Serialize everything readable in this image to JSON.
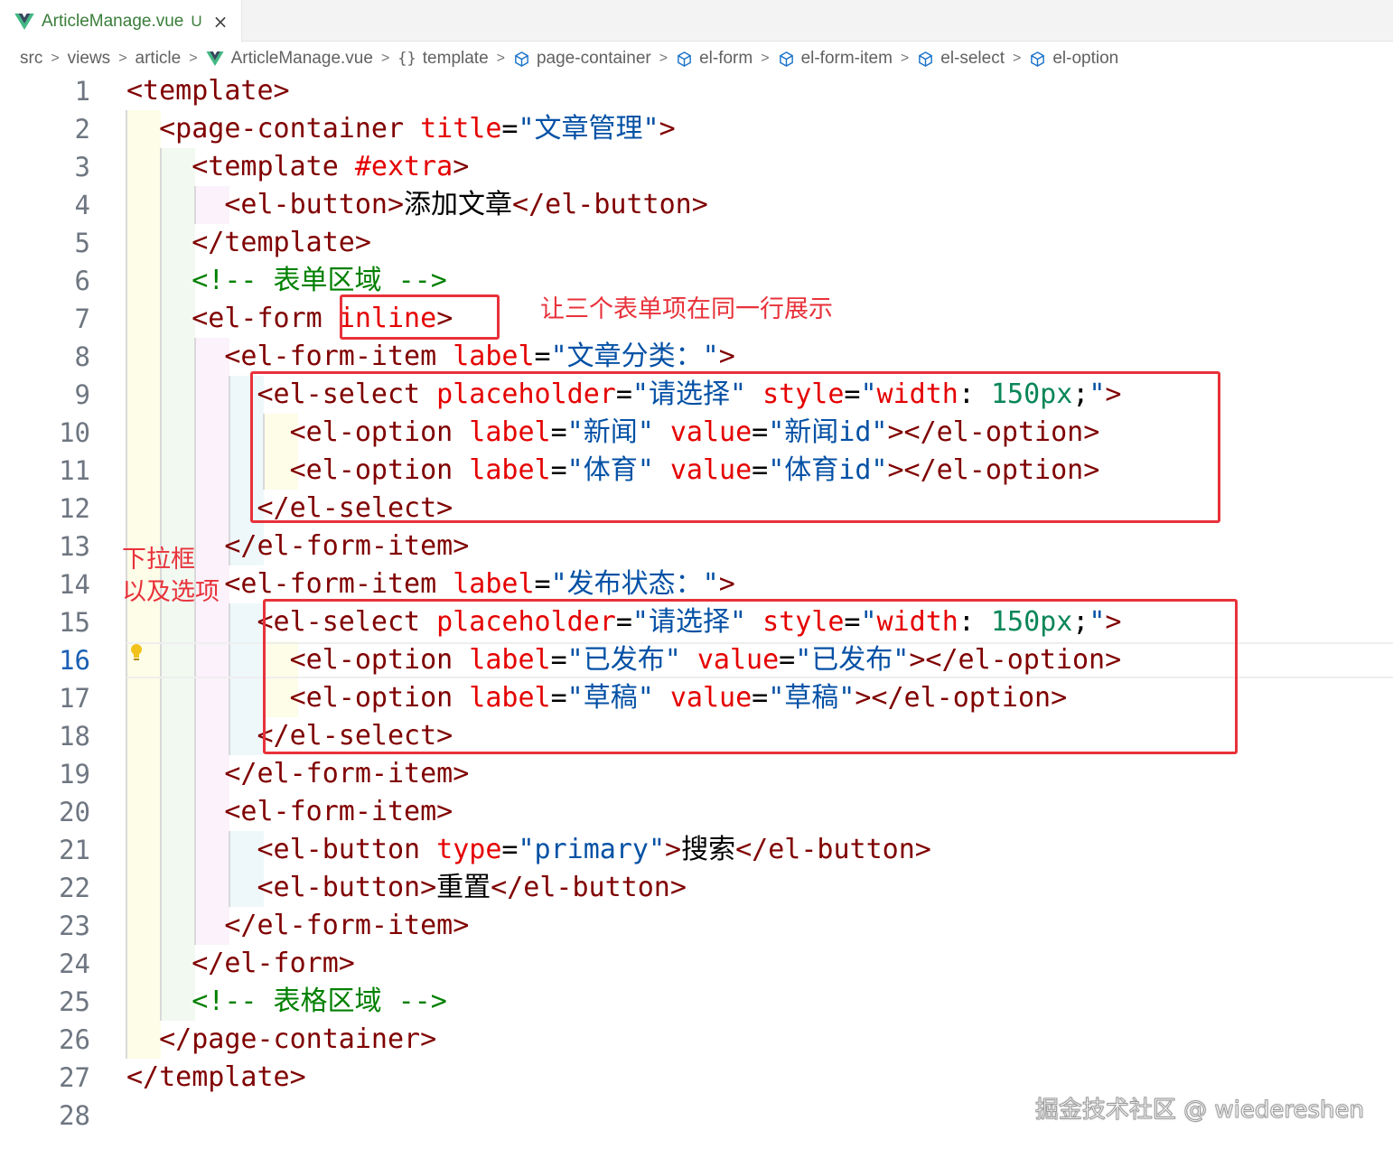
{
  "tab": {
    "file_name": "ArticleManage.vue",
    "status": "U",
    "close_glyph": "×",
    "vue_icon": "vue-logo-icon"
  },
  "breadcrumb": {
    "separator": ">",
    "items": [
      "src",
      "views",
      "article",
      "ArticleManage.vue",
      "template",
      "page-container",
      "el-form",
      "el-form-item",
      "el-select",
      "el-option"
    ],
    "braces": "{}"
  },
  "editor": {
    "active_line": 16,
    "line_numbers": [
      "1",
      "2",
      "3",
      "4",
      "5",
      "6",
      "7",
      "8",
      "9",
      "10",
      "11",
      "12",
      "13",
      "14",
      "15",
      "16",
      "17",
      "18",
      "19",
      "20",
      "21",
      "22",
      "23",
      "24",
      "25",
      "26",
      "27",
      "28"
    ],
    "lines": [
      [
        {
          "t": "tag",
          "v": "<template>"
        }
      ],
      [
        {
          "t": "tag",
          "v": "  <page-container "
        },
        {
          "t": "attr",
          "v": "title"
        },
        {
          "t": "eq",
          "v": "="
        },
        {
          "t": "str",
          "v": "\"文章管理\""
        },
        {
          "t": "tag",
          "v": ">"
        }
      ],
      [
        {
          "t": "tag",
          "v": "    <template "
        },
        {
          "t": "attr",
          "v": "#extra"
        },
        {
          "t": "tag",
          "v": ">"
        }
      ],
      [
        {
          "t": "tag",
          "v": "      <el-button>"
        },
        {
          "t": "txt",
          "v": "添加文章"
        },
        {
          "t": "tag",
          "v": "</el-button>"
        }
      ],
      [
        {
          "t": "tag",
          "v": "    </template>"
        }
      ],
      [
        {
          "t": "cmt",
          "v": "    <!-- 表单区域 -->"
        }
      ],
      [
        {
          "t": "tag",
          "v": "    <el-form "
        },
        {
          "t": "attr",
          "v": "inline"
        },
        {
          "t": "tag",
          "v": ">"
        }
      ],
      [
        {
          "t": "tag",
          "v": "      <el-form-item "
        },
        {
          "t": "attr",
          "v": "label"
        },
        {
          "t": "eq",
          "v": "="
        },
        {
          "t": "str",
          "v": "\"文章分类：\""
        },
        {
          "t": "tag",
          "v": ">"
        }
      ],
      [
        {
          "t": "tag",
          "v": "        <el-select "
        },
        {
          "t": "attr",
          "v": "placeholder"
        },
        {
          "t": "eq",
          "v": "="
        },
        {
          "t": "str",
          "v": "\"请选择\" "
        },
        {
          "t": "attr",
          "v": "style"
        },
        {
          "t": "eq",
          "v": "="
        },
        {
          "t": "str",
          "v": "\""
        },
        {
          "t": "attr",
          "v": "width"
        },
        {
          "t": "eq",
          "v": ": "
        },
        {
          "t": "num",
          "v": "150px"
        },
        {
          "t": "eq",
          "v": ";"
        },
        {
          "t": "str",
          "v": "\""
        },
        {
          "t": "tag",
          "v": ">"
        }
      ],
      [
        {
          "t": "tag",
          "v": "          <el-option "
        },
        {
          "t": "attr",
          "v": "label"
        },
        {
          "t": "eq",
          "v": "="
        },
        {
          "t": "str",
          "v": "\"新闻\" "
        },
        {
          "t": "attr",
          "v": "value"
        },
        {
          "t": "eq",
          "v": "="
        },
        {
          "t": "str",
          "v": "\"新闻id\""
        },
        {
          "t": "tag",
          "v": "></el-option>"
        }
      ],
      [
        {
          "t": "tag",
          "v": "          <el-option "
        },
        {
          "t": "attr",
          "v": "label"
        },
        {
          "t": "eq",
          "v": "="
        },
        {
          "t": "str",
          "v": "\"体育\" "
        },
        {
          "t": "attr",
          "v": "value"
        },
        {
          "t": "eq",
          "v": "="
        },
        {
          "t": "str",
          "v": "\"体育id\""
        },
        {
          "t": "tag",
          "v": "></el-option>"
        }
      ],
      [
        {
          "t": "tag",
          "v": "        </el-select>"
        }
      ],
      [
        {
          "t": "tag",
          "v": "      </el-form-item>"
        }
      ],
      [
        {
          "t": "tag",
          "v": "      <el-form-item "
        },
        {
          "t": "attr",
          "v": "label"
        },
        {
          "t": "eq",
          "v": "="
        },
        {
          "t": "str",
          "v": "\"发布状态：\""
        },
        {
          "t": "tag",
          "v": ">"
        }
      ],
      [
        {
          "t": "tag",
          "v": "        <el-select "
        },
        {
          "t": "attr",
          "v": "placeholder"
        },
        {
          "t": "eq",
          "v": "="
        },
        {
          "t": "str",
          "v": "\"请选择\" "
        },
        {
          "t": "attr",
          "v": "style"
        },
        {
          "t": "eq",
          "v": "="
        },
        {
          "t": "str",
          "v": "\""
        },
        {
          "t": "attr",
          "v": "width"
        },
        {
          "t": "eq",
          "v": ": "
        },
        {
          "t": "num",
          "v": "150px"
        },
        {
          "t": "eq",
          "v": ";"
        },
        {
          "t": "str",
          "v": "\""
        },
        {
          "t": "tag",
          "v": ">"
        }
      ],
      [
        {
          "t": "tag",
          "v": "          <el-option "
        },
        {
          "t": "attr",
          "v": "label"
        },
        {
          "t": "eq",
          "v": "="
        },
        {
          "t": "str",
          "v": "\"已发布\" "
        },
        {
          "t": "attr",
          "v": "value"
        },
        {
          "t": "eq",
          "v": "="
        },
        {
          "t": "str",
          "v": "\"已发布\""
        },
        {
          "t": "tag",
          "v": "></el-option>"
        }
      ],
      [
        {
          "t": "tag",
          "v": "          <el-option "
        },
        {
          "t": "attr",
          "v": "label"
        },
        {
          "t": "eq",
          "v": "="
        },
        {
          "t": "str",
          "v": "\"草稿\" "
        },
        {
          "t": "attr",
          "v": "value"
        },
        {
          "t": "eq",
          "v": "="
        },
        {
          "t": "str",
          "v": "\"草稿\""
        },
        {
          "t": "tag",
          "v": "></el-option>"
        }
      ],
      [
        {
          "t": "tag",
          "v": "        </el-select>"
        }
      ],
      [
        {
          "t": "tag",
          "v": "      </el-form-item>"
        }
      ],
      [
        {
          "t": "tag",
          "v": "      <el-form-item>"
        }
      ],
      [
        {
          "t": "tag",
          "v": "        <el-button "
        },
        {
          "t": "attr",
          "v": "type"
        },
        {
          "t": "eq",
          "v": "="
        },
        {
          "t": "str",
          "v": "\"primary\""
        },
        {
          "t": "tag",
          "v": ">"
        },
        {
          "t": "txt",
          "v": "搜索"
        },
        {
          "t": "tag",
          "v": "</el-button>"
        }
      ],
      [
        {
          "t": "tag",
          "v": "        <el-button>"
        },
        {
          "t": "txt",
          "v": "重置"
        },
        {
          "t": "tag",
          "v": "</el-button>"
        }
      ],
      [
        {
          "t": "tag",
          "v": "      </el-form-item>"
        }
      ],
      [
        {
          "t": "tag",
          "v": "    </el-form>"
        }
      ],
      [
        {
          "t": "cmt",
          "v": "    <!-- 表格区域 -->"
        }
      ],
      [
        {
          "t": "tag",
          "v": "  </page-container>"
        }
      ],
      [
        {
          "t": "tag",
          "v": "</template>"
        }
      ],
      []
    ]
  },
  "annotations": {
    "inline_note": "让三个表单项在同一行展示",
    "select_note_line1": "下拉框",
    "select_note_line2": "以及选项"
  },
  "watermark": "掘金技术社区 @ wiedereshen",
  "colors": {
    "tag": "#800000",
    "attribute": "#e50000",
    "string": "#0451a5",
    "comment": "#008000",
    "number": "#098658",
    "annotation_red": "#e8313a",
    "vue_green": "#41b883"
  }
}
